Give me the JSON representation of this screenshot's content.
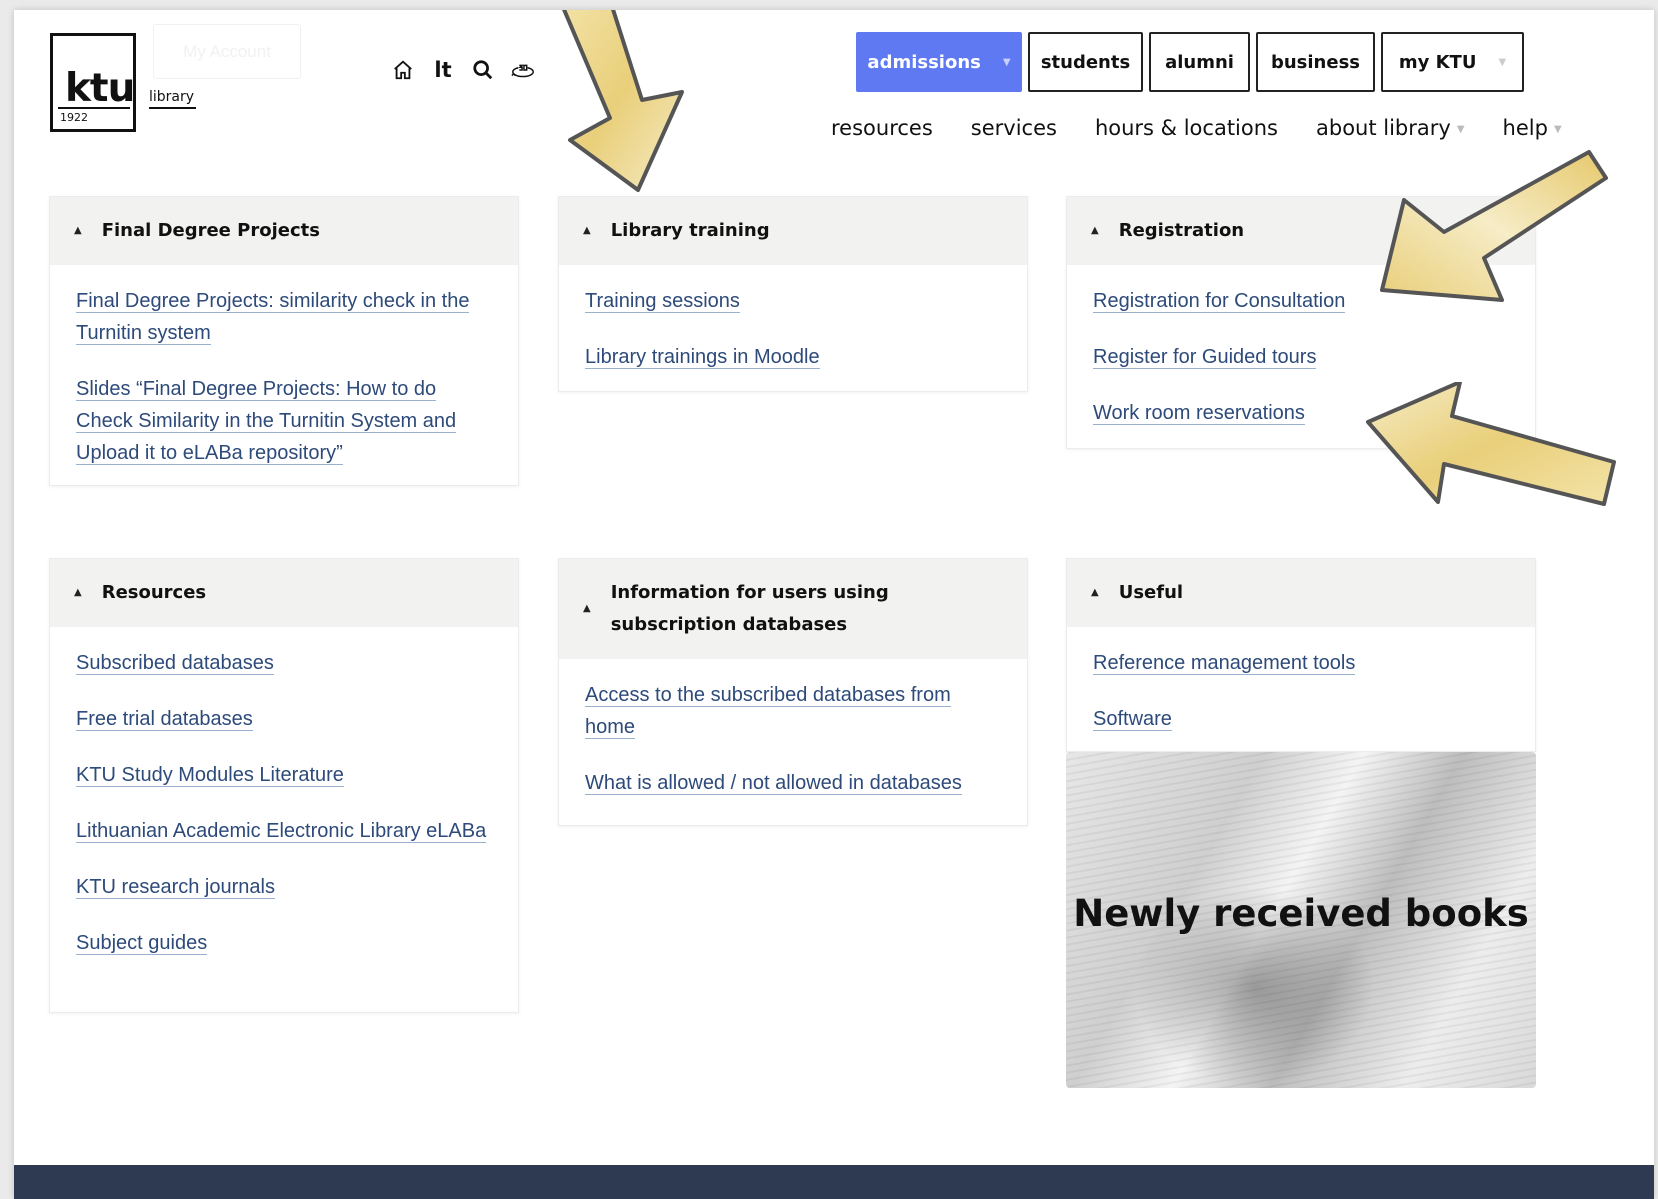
{
  "header": {
    "logo_text": "ktu",
    "logo_year": "1922",
    "logo_sub": "library",
    "ghost_button": "My Account",
    "lang": "lt",
    "icons": [
      "home-icon",
      "search-icon",
      "360-view-icon"
    ]
  },
  "topnav": [
    {
      "label": "admissions",
      "active": true,
      "has_caret": true
    },
    {
      "label": "students",
      "active": false
    },
    {
      "label": "alumni",
      "active": false
    },
    {
      "label": "business",
      "active": false
    },
    {
      "label": "my KTU",
      "active": false,
      "has_caret": true
    }
  ],
  "mainnav": [
    {
      "label": "resources"
    },
    {
      "label": "services"
    },
    {
      "label": "hours & locations"
    },
    {
      "label": "about library",
      "has_caret": true
    },
    {
      "label": "help",
      "has_caret": true
    }
  ],
  "cards": {
    "final": {
      "title": "Final Degree Projects",
      "links": [
        "Final Degree Projects: similarity check in the Turnitin system",
        "Slides “Final Degree Projects: How to do Check Similarity in the Turnitin System and Upload it to eLABa repository”"
      ]
    },
    "training": {
      "title": "Library training",
      "links": [
        "Training sessions",
        "Library trainings in Moodle"
      ]
    },
    "registration": {
      "title": "Registration",
      "links": [
        "Registration for Consultation",
        "Register for Guided tours",
        "Work room reservations"
      ]
    },
    "resources": {
      "title": "Resources",
      "links": [
        "Subscribed databases",
        "Free trial databases",
        "KTU Study Modules Literature",
        "Lithuanian Academic Electronic Library eLABa",
        "KTU research journals",
        "Subject guides"
      ]
    },
    "info": {
      "title": "Information for users using subscription databases",
      "links": [
        "Access to the subscribed databases from home",
        "What is allowed / not allowed in databases"
      ]
    },
    "useful": {
      "title": "Useful",
      "links": [
        "Reference management tools",
        "Software"
      ]
    }
  },
  "books_banner": {
    "title": "Newly received books"
  },
  "colors": {
    "accent": "#5e79f2",
    "link": "#2d4a7a",
    "footer": "#2d3a52",
    "card_head": "#f2f2f0"
  }
}
